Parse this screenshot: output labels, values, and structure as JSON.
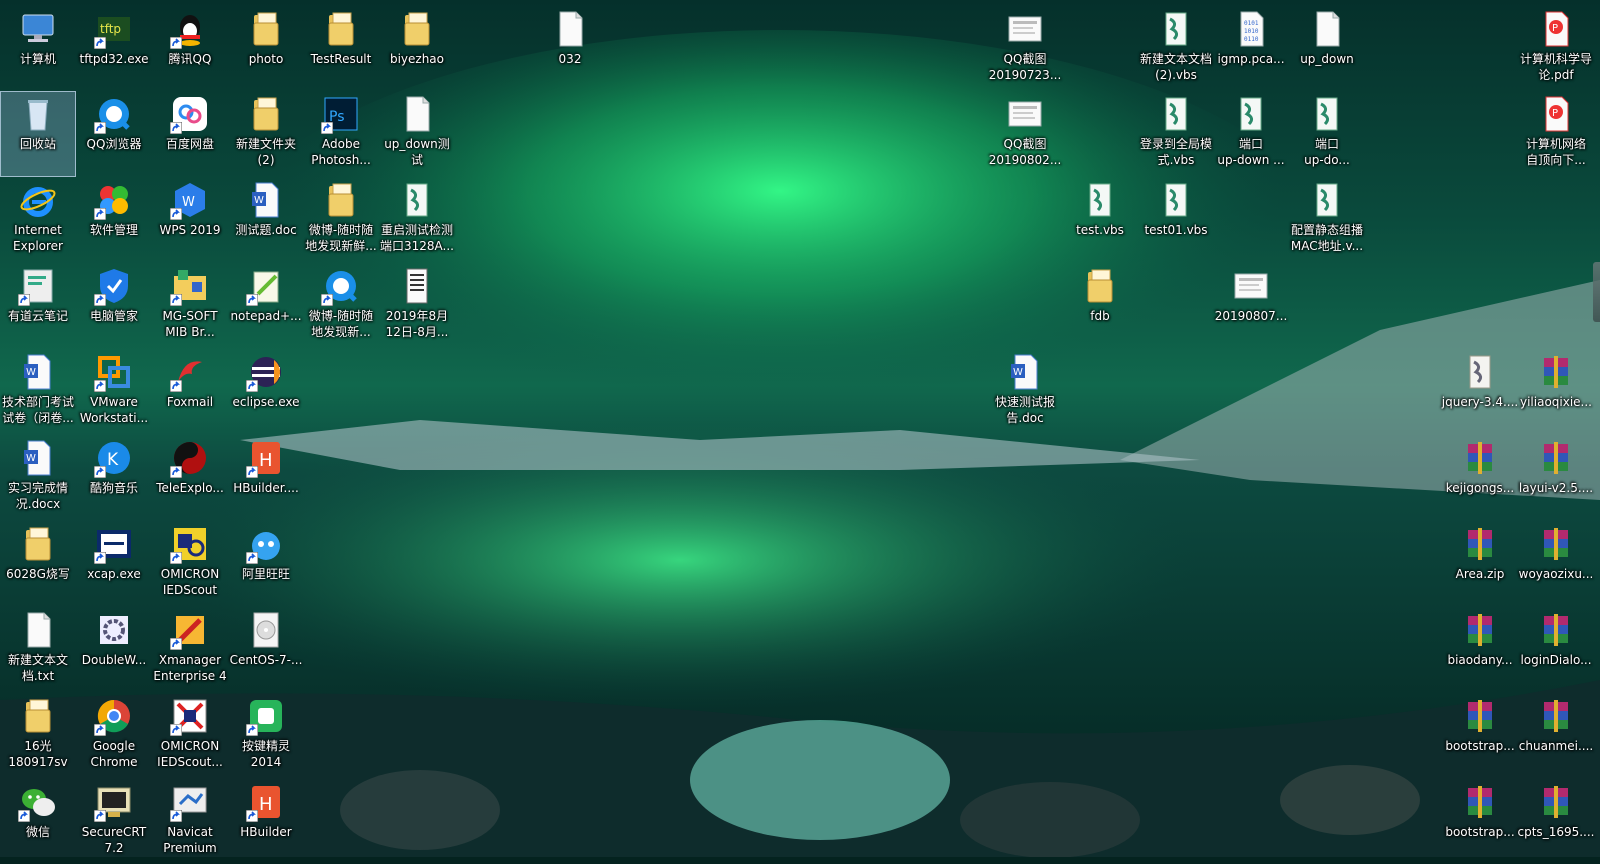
{
  "desktop": {
    "icons": [
      {
        "id": "computer",
        "label": "计算机",
        "kind": "computer",
        "shortcut": false
      },
      {
        "id": "tftpd32",
        "label": "tftpd32.exe",
        "kind": "tftp",
        "shortcut": true
      },
      {
        "id": "qq",
        "label": "腾讯QQ",
        "kind": "qq",
        "shortcut": true
      },
      {
        "id": "photo",
        "label": "photo",
        "kind": "folder",
        "shortcut": false
      },
      {
        "id": "testresult",
        "label": "TestResult",
        "kind": "folder",
        "shortcut": false
      },
      {
        "id": "biyezhao",
        "label": "biyezhao",
        "kind": "folder",
        "shortcut": false
      },
      {
        "id": "f032",
        "label": "032",
        "kind": "file",
        "shortcut": false
      },
      {
        "id": "qqshot1",
        "label": "QQ截图\n20190723...",
        "kind": "image",
        "shortcut": false
      },
      {
        "id": "vbs_new2",
        "label": "新建文本文档\n(2).vbs",
        "kind": "vbs",
        "shortcut": false
      },
      {
        "id": "igmp",
        "label": "igmp.pca...",
        "kind": "binary",
        "shortcut": false
      },
      {
        "id": "updown",
        "label": "up_down",
        "kind": "file",
        "shortcut": false
      },
      {
        "id": "pdf1",
        "label": "计算机科学导\n论.pdf",
        "kind": "pdf",
        "shortcut": false
      },
      {
        "id": "recycle",
        "label": "回收站",
        "kind": "recycle",
        "shortcut": false,
        "selected": true
      },
      {
        "id": "qqbrowser",
        "label": "QQ浏览器",
        "kind": "qqbrowser",
        "shortcut": true
      },
      {
        "id": "baidupan",
        "label": "百度网盘",
        "kind": "baidupan",
        "shortcut": true
      },
      {
        "id": "newfolder2",
        "label": "新建文件夹\n(2)",
        "kind": "folder",
        "shortcut": false
      },
      {
        "id": "photoshop",
        "label": "Adobe\nPhotosh...",
        "kind": "photoshop",
        "shortcut": true
      },
      {
        "id": "updowntest",
        "label": "up_down测\n试",
        "kind": "file",
        "shortcut": false
      },
      {
        "id": "qqshot2",
        "label": "QQ截图\n20190802...",
        "kind": "image",
        "shortcut": false
      },
      {
        "id": "loginvbs",
        "label": "登录到全局模\n式.vbs",
        "kind": "vbs",
        "shortcut": false
      },
      {
        "id": "port1",
        "label": "端口\nup-down ...",
        "kind": "vbs",
        "shortcut": false
      },
      {
        "id": "port2",
        "label": "端口\nup-do...",
        "kind": "vbs",
        "shortcut": false
      },
      {
        "id": "pdf2",
        "label": "计算机网络\n自顶向下...",
        "kind": "pdf",
        "shortcut": false
      },
      {
        "id": "ie",
        "label": "Internet\nExplorer",
        "kind": "ie",
        "shortcut": false
      },
      {
        "id": "softmgr",
        "label": "软件管理",
        "kind": "softmgr",
        "shortcut": true
      },
      {
        "id": "wps",
        "label": "WPS 2019",
        "kind": "wps",
        "shortcut": true
      },
      {
        "id": "testdoc",
        "label": "测试题.doc",
        "kind": "word",
        "shortcut": false
      },
      {
        "id": "weibo1",
        "label": "微博-随时随\n地发现新鲜...",
        "kind": "folder",
        "shortcut": false
      },
      {
        "id": "restart",
        "label": "重启测试检测\n端口3128A...",
        "kind": "vbs",
        "shortcut": false
      },
      {
        "id": "testvbs",
        "label": "test.vbs",
        "kind": "vbs",
        "shortcut": false
      },
      {
        "id": "test01vbs",
        "label": "test01.vbs",
        "kind": "vbs",
        "shortcut": false
      },
      {
        "id": "staticmac",
        "label": "配置静态组播\nMAC地址.v...",
        "kind": "vbs",
        "shortcut": false
      },
      {
        "id": "youdao",
        "label": "有道云笔记",
        "kind": "youdao",
        "shortcut": true
      },
      {
        "id": "pcmgr",
        "label": "电脑管家",
        "kind": "pcmgr",
        "shortcut": true
      },
      {
        "id": "mgsoft",
        "label": "MG-SOFT\nMIB Br...",
        "kind": "mgsoft",
        "shortcut": true
      },
      {
        "id": "notepadpp",
        "label": "notepad+...",
        "kind": "notepad",
        "shortcut": true
      },
      {
        "id": "weibo2",
        "label": "微博-随时随\n地发现新...",
        "kind": "qqbrowser",
        "shortcut": true
      },
      {
        "id": "aug2019",
        "label": "2019年8月\n12日-8月...",
        "kind": "doclist",
        "shortcut": false
      },
      {
        "id": "fdb",
        "label": "fdb",
        "kind": "folder",
        "shortcut": false
      },
      {
        "id": "img0807",
        "label": "20190807...",
        "kind": "image",
        "shortcut": false
      },
      {
        "id": "techexam",
        "label": "技术部门考试\n试卷（闭卷...",
        "kind": "word",
        "shortcut": false
      },
      {
        "id": "vmware",
        "label": "VMware\nWorkstati...",
        "kind": "vmware",
        "shortcut": true
      },
      {
        "id": "foxmail",
        "label": "Foxmail",
        "kind": "foxmail",
        "shortcut": true
      },
      {
        "id": "eclipse",
        "label": "eclipse.exe",
        "kind": "eclipse",
        "shortcut": true
      },
      {
        "id": "quicktest",
        "label": "快速测试报\n告.doc",
        "kind": "word",
        "shortcut": false
      },
      {
        "id": "jquery",
        "label": "jquery-3.4....",
        "kind": "script",
        "shortcut": false
      },
      {
        "id": "yiliao",
        "label": "yiliaoqixie...",
        "kind": "rar",
        "shortcut": false
      },
      {
        "id": "internship",
        "label": "实习完成情\n况.docx",
        "kind": "word",
        "shortcut": false
      },
      {
        "id": "kugou",
        "label": "酷狗音乐",
        "kind": "kugou",
        "shortcut": true
      },
      {
        "id": "teleexplorer",
        "label": "TeleExplo...",
        "kind": "tele",
        "shortcut": true
      },
      {
        "id": "hbuilder1",
        "label": "HBuilder....",
        "kind": "hbuilder",
        "shortcut": true
      },
      {
        "id": "kejigongs",
        "label": "kejigongs...",
        "kind": "rar",
        "shortcut": false
      },
      {
        "id": "layui",
        "label": "layui-v2.5....",
        "kind": "rar",
        "shortcut": false
      },
      {
        "id": "g6028",
        "label": "6028G烧写",
        "kind": "folder",
        "shortcut": false
      },
      {
        "id": "xcap",
        "label": "xcap.exe",
        "kind": "xcap",
        "shortcut": true
      },
      {
        "id": "omicron1",
        "label": "OMICRON\nIEDScout",
        "kind": "omicron",
        "shortcut": true
      },
      {
        "id": "aliwangwang",
        "label": "阿里旺旺",
        "kind": "wangwang",
        "shortcut": true
      },
      {
        "id": "areazip",
        "label": "Area.zip",
        "kind": "rar",
        "shortcut": false
      },
      {
        "id": "woyaozixu",
        "label": "woyaozixu...",
        "kind": "rar",
        "shortcut": false
      },
      {
        "id": "newtxt",
        "label": "新建文本文\n档.txt",
        "kind": "file",
        "shortcut": false
      },
      {
        "id": "doublew",
        "label": "DoubleW...",
        "kind": "gear",
        "shortcut": false
      },
      {
        "id": "xmanager",
        "label": "Xmanager\nEnterprise 4",
        "kind": "xmanager",
        "shortcut": true
      },
      {
        "id": "centos",
        "label": "CentOS-7-...",
        "kind": "disc",
        "shortcut": false
      },
      {
        "id": "biaodany",
        "label": "biaodany...",
        "kind": "rar",
        "shortcut": false
      },
      {
        "id": "logindialo",
        "label": "loginDialo...",
        "kind": "rar",
        "shortcut": false
      },
      {
        "id": "g16",
        "label": "16光\n180917sv",
        "kind": "folder",
        "shortcut": false
      },
      {
        "id": "chrome",
        "label": "Google\nChrome",
        "kind": "chrome",
        "shortcut": true
      },
      {
        "id": "omicron2",
        "label": "OMICRON\nIEDScout...",
        "kind": "omicron2",
        "shortcut": true
      },
      {
        "id": "anjian",
        "label": "按键精灵\n2014",
        "kind": "anjian",
        "shortcut": true
      },
      {
        "id": "bootstrap1",
        "label": "bootstrap...",
        "kind": "rar",
        "shortcut": false
      },
      {
        "id": "chuanmei",
        "label": "chuanmei....",
        "kind": "rar",
        "shortcut": false
      },
      {
        "id": "wechat",
        "label": "微信",
        "kind": "wechat",
        "shortcut": true
      },
      {
        "id": "securecrt",
        "label": "SecureCRT\n7.2",
        "kind": "securecrt",
        "shortcut": true
      },
      {
        "id": "navicat",
        "label": "Navicat\nPremium",
        "kind": "navicat",
        "shortcut": true
      },
      {
        "id": "hbuilder2",
        "label": "HBuilder",
        "kind": "hbuilder",
        "shortcut": true
      },
      {
        "id": "bootstrap2",
        "label": "bootstrap...",
        "kind": "rar",
        "shortcut": false
      },
      {
        "id": "cpts",
        "label": "cpts_1695....",
        "kind": "rar",
        "shortcut": false
      }
    ]
  },
  "colors": {
    "label": "#ffffff",
    "aurora": "#2ee07a",
    "selection": "#9ec4ee"
  }
}
